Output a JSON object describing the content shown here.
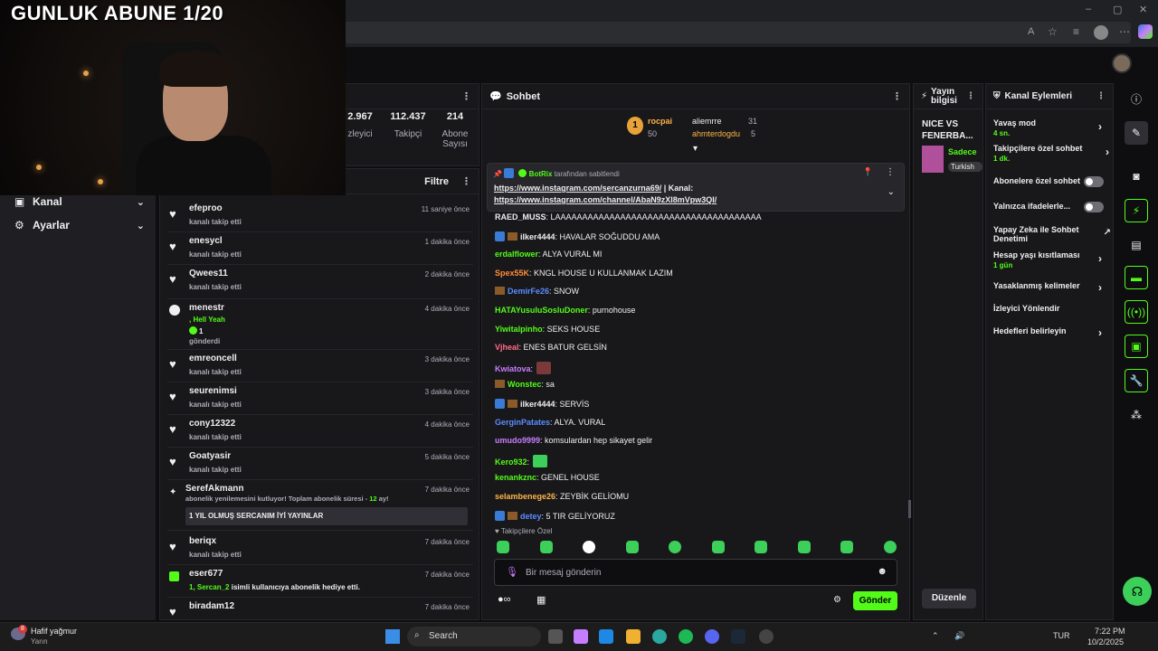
{
  "browser": {
    "window_controls": [
      "–",
      "▢",
      "✕"
    ]
  },
  "stream": {
    "overlay_title": "GUNLUK ABUNE 1/20"
  },
  "left_nav": {
    "items": [
      {
        "label": "Kanal"
      },
      {
        "label": "Ayarlar"
      }
    ]
  },
  "stats": {
    "items": [
      {
        "value": "2.967",
        "label": "zleyici"
      },
      {
        "value": "112.437",
        "label": "Takipçi"
      },
      {
        "value": "214",
        "label": "Abone Sayısı"
      }
    ]
  },
  "activity": {
    "filter_label": "Filtre",
    "rows": [
      {
        "name": "efeproo",
        "sub": "kanalı takip etti",
        "time": "11 saniye önce"
      },
      {
        "name": "enesycl",
        "sub": "kanalı takip etti",
        "time": "1 dakika önce"
      },
      {
        "name": "Qwees11",
        "sub": "kanalı takip etti",
        "time": "2 dakika önce"
      },
      {
        "name": "menestr",
        "extra": ", Hell Yeah",
        "extra2": "1",
        "sub": "gönderdi",
        "time": "4 dakika önce"
      },
      {
        "name": "emreoncell",
        "sub": "kanalı takip etti",
        "time": "3 dakika önce"
      },
      {
        "name": "seurenimsi",
        "sub": "kanalı takip etti",
        "time": "3 dakika önce"
      },
      {
        "name": "cony12322",
        "sub": "kanalı takip etti",
        "time": "4 dakika önce"
      },
      {
        "name": "Goatyasir",
        "sub": "kanalı takip etti",
        "time": "5 dakika önce"
      },
      {
        "name": "SerefAkmann",
        "sub": "abonelik yenilemesini kutluyor! Toplam abonelik süresi -",
        "months": "12",
        "months_suffix": "ay!",
        "message": "1 YIL OLMUŞ SERCANIM İYİ YAYINLAR",
        "time": "7 dakika önce"
      },
      {
        "name": "beriqx",
        "sub": "kanalı takip etti",
        "time": "7 dakika önce"
      },
      {
        "name": "eser677",
        "sub": "isimli kullanıcıya abonelik hediye etti.",
        "gift": "1, Sercan_2",
        "time": "7 dakika önce"
      },
      {
        "name": "biradam12",
        "sub": "",
        "time": "7 dakika önce"
      }
    ]
  },
  "chat": {
    "title": "Sohbet",
    "leaders": [
      {
        "rank": "1",
        "name": "rocpai",
        "count": "50"
      },
      {
        "name": "aliemrre",
        "count": "31"
      },
      {
        "name": "ahmterdogdu",
        "count": "5"
      }
    ],
    "pinned": {
      "author": "BotRix",
      "suffix": "tarafından sabitlendi",
      "line1": "https://www.instagram.com/sercanzurna69/",
      "line1b": " | Kanal:",
      "line2": "https://www.instagram.com/channel/AbaN9zXI8mVpw3QI/"
    },
    "messages": [
      {
        "user": "RAED_MUSS",
        "color": "#efeff1",
        "text": ": LAAAAAAAAAAAAAAAAAAAAAAAAAAAAAAAAAAAAAA"
      },
      {
        "user": "ilker4444",
        "color": "#efeff1",
        "text": ": HAVALAR SOĞUDDU AMA",
        "badges": 2
      },
      {
        "user": "erdalflower",
        "color": "#53fc18",
        "text": ": ALYA VURAL MI"
      },
      {
        "user": "Spex55K",
        "color": "#ff8c3a",
        "text": ": KNGL HOUSE U KULLANMAK LAZIM"
      },
      {
        "user": "DemirFe26",
        "color": "#5b8cff",
        "text": ": SNOW",
        "badges": 1
      },
      {
        "user": "HATAYusuluSosluDoner",
        "color": "#53fc18",
        "text": ": purnohouse"
      },
      {
        "user": "Yiwitalpinho",
        "color": "#53fc18",
        "text": ": SEKS HOUSE"
      },
      {
        "user": "Vjheal",
        "color": "#ff6b8b",
        "text": ": ENES BATUR GELSİN"
      },
      {
        "user": "Kwiatova",
        "color": "#c77dff",
        "text": ":"
      },
      {
        "user": "Wonstec",
        "color": "#53fc18",
        "text": ": sa",
        "badges": 1
      },
      {
        "user": "ilker4444",
        "color": "#efeff1",
        "text": ": SERVİS",
        "badges": 2
      },
      {
        "user": "GerginPatates",
        "color": "#5b8cff",
        "text": ": ALYA. VURAL"
      },
      {
        "user": "umudo9999",
        "color": "#c77dff",
        "text": ": komsulardan hep sikayet gelir"
      },
      {
        "user": "Kero932",
        "color": "#53fc18",
        "text": ":"
      },
      {
        "user": "kenankznc",
        "color": "#53fc18",
        "text": ": GENEL HOUSE"
      },
      {
        "user": "selambenege26",
        "color": "#ffb347",
        "text": ": ZEYBİK GELİOMU"
      },
      {
        "user": "detey",
        "color": "#5b8cff",
        "text": ": 5 TIR GELİYORUZ",
        "badges": 2
      }
    ],
    "followers_only": "Takipçilere Özel",
    "input_placeholder": "Bir mesaj gönderin",
    "send_label": "Gönder"
  },
  "stream_info": {
    "title": "Yayın bilgisi",
    "stream_title": "NICE VS FENERBA...",
    "category": "Sadece",
    "tag": "Turkish",
    "edit_label": "Düzenle"
  },
  "channel_actions": {
    "title": "Kanal Eylemleri",
    "items": [
      {
        "label": "Yavaş mod",
        "sub": "4 sn.",
        "type": "chevron"
      },
      {
        "label": "Takipçilere özel sohbet",
        "sub": "1 dk.",
        "type": "chevron"
      },
      {
        "label": "Abonelere özel sohbet",
        "type": "toggle"
      },
      {
        "label": "Yalnızca ifadelerle...",
        "type": "toggle"
      },
      {
        "label": "Yapay Zeka ile Sohbet Denetimi",
        "type": "external"
      },
      {
        "label": "Hesap yaşı kısıtlaması",
        "sub": "1 gün",
        "type": "chevron"
      },
      {
        "label": "Yasaklanmış kelimeler",
        "type": "chevron"
      },
      {
        "label": "İzleyici Yönlendir",
        "type": "none"
      },
      {
        "label": "Hedefleri belirleyin",
        "type": "chevron"
      }
    ]
  },
  "taskbar": {
    "weather_title": "Hafif yağmur",
    "weather_sub": "Yarın",
    "search_label": "Search",
    "lang": "TUR",
    "time": "7:22 PM",
    "date": "10/2/2025",
    "badge_count": "8"
  },
  "colors": {
    "accent": "#53fc18",
    "panel": "#18181b",
    "bg": "#0e0e10"
  }
}
